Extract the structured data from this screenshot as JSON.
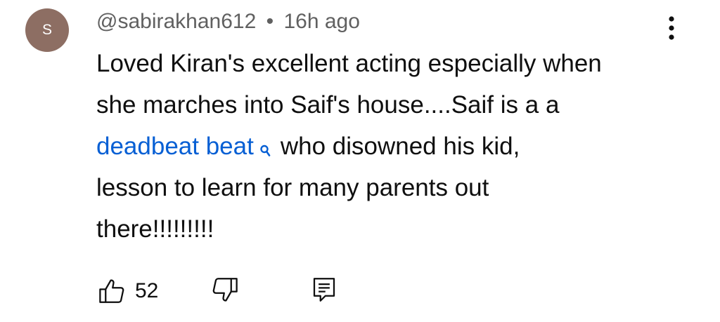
{
  "comment": {
    "avatar_letter": "S",
    "avatar_color": "#8d6e63",
    "author": "@sabirakhan612",
    "separator": "•",
    "timestamp": "16h ago",
    "text_lines": [
      "Loved Kiran's excellent acting especially when",
      "she marches into Saif's house....Saif is a a"
    ],
    "linked_term": "deadbeat beat",
    "line3_rest": "who disowned his kid,",
    "text_lines_end": [
      "lesson to learn for many parents out",
      "there!!!!!!!!!"
    ],
    "link_color": "#065fd4"
  },
  "actions": {
    "like_count": "52",
    "like_icon": "thumbs-up-icon",
    "dislike_icon": "thumbs-down-icon",
    "reply_icon": "comment-reply-icon"
  },
  "menu": {
    "icon": "more-vertical-icon"
  }
}
